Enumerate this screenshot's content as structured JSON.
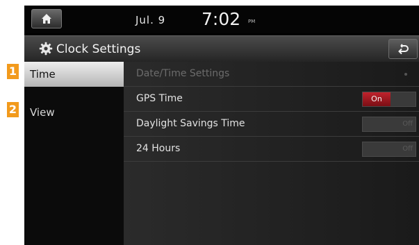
{
  "status": {
    "date": "Jul.  9",
    "time": "7:02",
    "ampm": "PM"
  },
  "header": {
    "title": "Clock Settings"
  },
  "callouts": [
    "1",
    "2"
  ],
  "menu": {
    "items": [
      {
        "label": "Time"
      },
      {
        "label": "View"
      }
    ]
  },
  "settings": {
    "rows": [
      {
        "label": "Date/Time Settings"
      },
      {
        "label": "GPS Time",
        "toggle": "On"
      },
      {
        "label": "Daylight Savings Time",
        "toggle": "Off"
      },
      {
        "label": "24 Hours",
        "toggle": "Off"
      }
    ]
  },
  "colors": {
    "callout": "#f29a1c",
    "toggle_on": "#b01e27",
    "selected_tab": "#dcdcdc"
  },
  "icons": {
    "home": "home-icon",
    "settings": "gear-icon",
    "back": "back-arrow-icon"
  }
}
